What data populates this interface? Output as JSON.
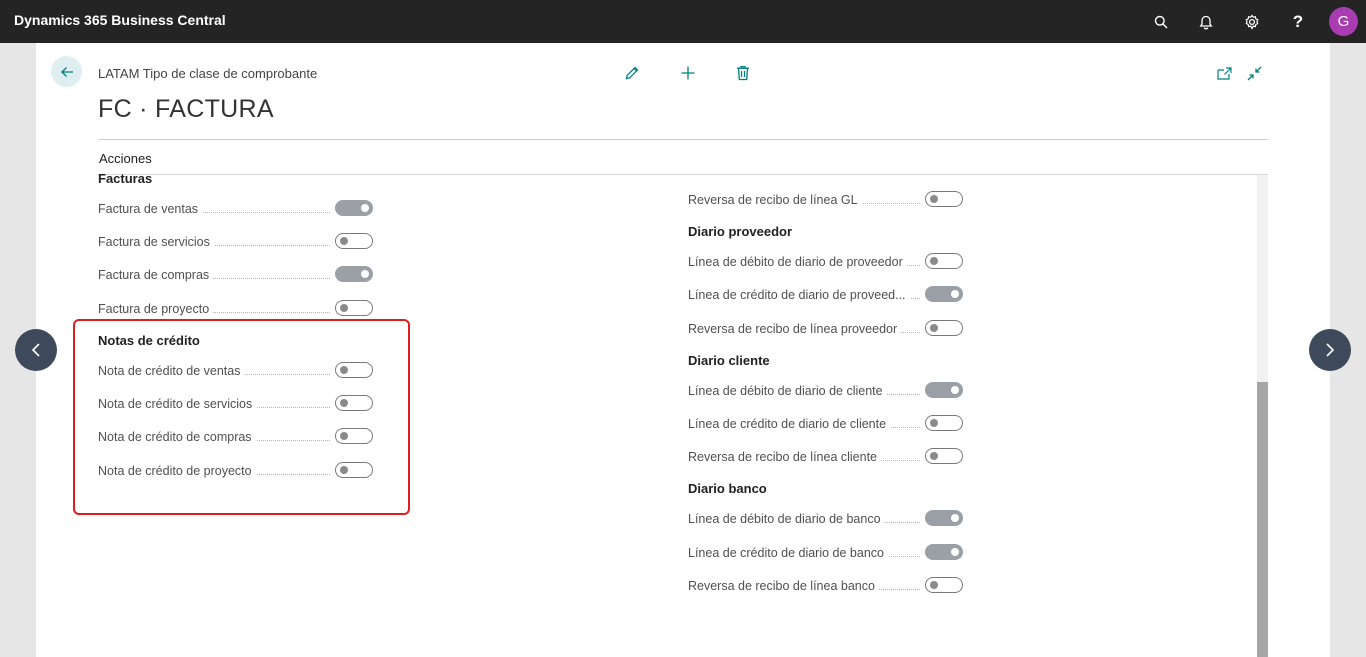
{
  "app": {
    "title": "Dynamics 365 Business Central",
    "user_initial": "G"
  },
  "header": {
    "breadcrumb": "LATAM Tipo de clase de comprobante",
    "title": "FC · FACTURA",
    "actions_label": "Acciones"
  },
  "left_groups": {
    "facturas": {
      "header": "Facturas",
      "fields": [
        {
          "label": "Factura de ventas",
          "on": true
        },
        {
          "label": "Factura de servicios",
          "on": false
        },
        {
          "label": "Factura de compras",
          "on": true
        },
        {
          "label": "Factura de proyecto",
          "on": false
        }
      ]
    },
    "notas_credito": {
      "header": "Notas de crédito",
      "fields": [
        {
          "label": "Nota de crédito de ventas",
          "on": false
        },
        {
          "label": "Nota de crédito de servicios",
          "on": false
        },
        {
          "label": "Nota de crédito de compras",
          "on": false
        },
        {
          "label": "Nota de crédito de proyecto",
          "on": false
        }
      ]
    }
  },
  "right_groups": {
    "gl": {
      "fields": [
        {
          "label": "Reversa de recibo de línea GL",
          "on": false
        }
      ]
    },
    "proveedor": {
      "header": "Diario proveedor",
      "fields": [
        {
          "label": "Línea de débito de diario de proveedor",
          "on": false
        },
        {
          "label": "Línea de crédito de diario de proveed...",
          "on": true
        },
        {
          "label": "Reversa de recibo de línea proveedor",
          "on": false
        }
      ]
    },
    "cliente": {
      "header": "Diario cliente",
      "fields": [
        {
          "label": "Línea de débito de diario de cliente",
          "on": true
        },
        {
          "label": "Línea de crédito de diario de cliente",
          "on": false
        },
        {
          "label": "Reversa de recibo de línea cliente",
          "on": false
        }
      ]
    },
    "banco": {
      "header": "Diario banco",
      "fields": [
        {
          "label": "Línea de débito de diario de banco",
          "on": true
        },
        {
          "label": "Línea de crédito de diario de banco",
          "on": true
        },
        {
          "label": "Reversa de recibo de línea banco",
          "on": false
        }
      ]
    }
  },
  "icons": {
    "topbar": [
      "search-icon",
      "bell-icon",
      "gear-icon",
      "help-icon"
    ],
    "actions": [
      "edit-icon",
      "add-icon",
      "delete-icon",
      "open-new-window-icon",
      "collapse-icon"
    ],
    "nav": [
      "chevron-left-icon",
      "chevron-right-icon"
    ]
  },
  "colors": {
    "topbar": "#242424",
    "avatar": "#a83cb0",
    "accent": "#00807f",
    "highlight": "#e01e1e",
    "toggle_on": "#9aa0a6",
    "nav_button": "#3e4a5c"
  }
}
